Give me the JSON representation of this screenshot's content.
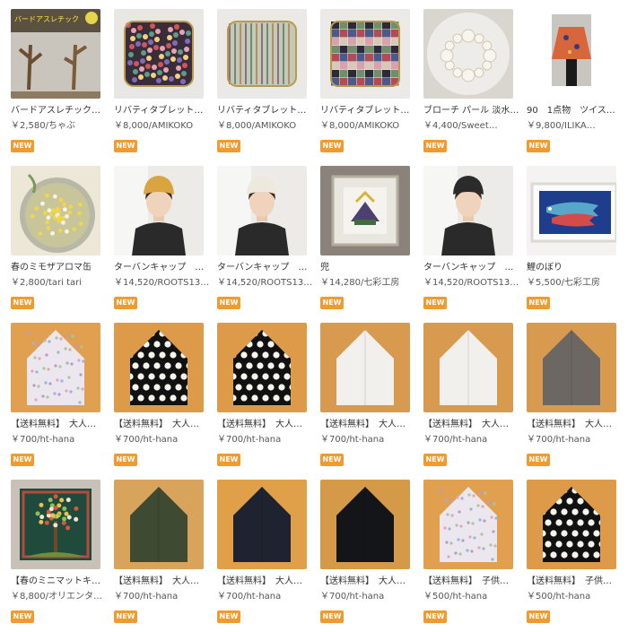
{
  "colors": {
    "badge": "#f39a2e",
    "text": "#333333",
    "meta": "#555555"
  },
  "products": [
    {
      "title": "バードアスレチック…",
      "meta": "￥2,580/ちゃぶ",
      "badge": "NEW",
      "image": "bird-athletic",
      "thumb_text": "バードアスレチック"
    },
    {
      "title": "リバティタブレット…",
      "meta": "￥8,000/AMIKOKO",
      "badge": "NEW",
      "image": "floral-tablet-case"
    },
    {
      "title": "リバティタブレット…",
      "meta": "￥8,000/AMIKOKO",
      "badge": "NEW",
      "image": "pattern-tablet-case"
    },
    {
      "title": "リバティタブレット…",
      "meta": "￥8,000/AMIKOKO",
      "badge": "NEW",
      "image": "patchwork-tablet-case"
    },
    {
      "title": "ブローチ パール 淡水…",
      "meta": "￥4,400/Sweet…",
      "badge": "NEW",
      "image": "pearl-brooch"
    },
    {
      "title": "90　1点物　ツイス…",
      "meta": "￥9,800/ILIKA…",
      "badge": "NEW",
      "image": "orange-blouse"
    },
    {
      "title": "春のミモザアロマ缶",
      "meta": "￥2,800/tari tari",
      "badge": "NEW",
      "image": "mimosa-aroma-can"
    },
    {
      "title": "ターバンキャップ　…",
      "meta": "￥14,520/ROOTS13…",
      "badge": "NEW",
      "image": "mustard-cap-model"
    },
    {
      "title": "ターバンキャップ　…",
      "meta": "￥14,520/ROOTS13…",
      "badge": "NEW",
      "image": "white-cap-model"
    },
    {
      "title": "兜",
      "meta": "￥14,280/七彩工房",
      "badge": "NEW",
      "image": "kabuto-frame"
    },
    {
      "title": "ターバンキャップ　…",
      "meta": "￥14,520/ROOTS13…",
      "badge": "NEW",
      "image": "black-cap-model"
    },
    {
      "title": "鯉のぼり",
      "meta": "￥5,500/七彩工房",
      "badge": "NEW",
      "image": "koinobori-frame"
    },
    {
      "title": "【送料無料】　大人…",
      "meta": "￥700/ht-hana",
      "badge": "NEW",
      "image": "floral-headscarf"
    },
    {
      "title": "【送料無料】　大人…",
      "meta": "￥700/ht-hana",
      "badge": "NEW",
      "image": "polka-headscarf"
    },
    {
      "title": "【送料無料】　大人…",
      "meta": "￥700/ht-hana",
      "badge": "NEW",
      "image": "polka-headscarf"
    },
    {
      "title": "【送料無料】　大人…",
      "meta": "￥700/ht-hana",
      "badge": "NEW",
      "image": "white-headscarf"
    },
    {
      "title": "【送料無料】　大人…",
      "meta": "￥700/ht-hana",
      "badge": "NEW",
      "image": "white-headscarf"
    },
    {
      "title": "【送料無料】　大人…",
      "meta": "￥700/ht-hana",
      "badge": "NEW",
      "image": "grey-headscarf"
    },
    {
      "title": "【春のミニマットキ…",
      "meta": "￥8,800/オリエンタ…",
      "badge": "NEW",
      "image": "tree-mini-mat"
    },
    {
      "title": "【送料無料】　大人…",
      "meta": "￥700/ht-hana",
      "badge": "NEW",
      "image": "green-headscarf"
    },
    {
      "title": "【送料無料】　大人…",
      "meta": "￥700/ht-hana",
      "badge": "NEW",
      "image": "navy-headscarf"
    },
    {
      "title": "【送料無料】　大人…",
      "meta": "￥700/ht-hana",
      "badge": "NEW",
      "image": "black-headscarf"
    },
    {
      "title": "【送料無料】　子供…",
      "meta": "￥500/ht-hana",
      "badge": "NEW",
      "image": "floral-headscarf"
    },
    {
      "title": "【送料無料】　子供…",
      "meta": "￥500/ht-hana",
      "badge": "NEW",
      "image": "polka-headscarf"
    }
  ]
}
